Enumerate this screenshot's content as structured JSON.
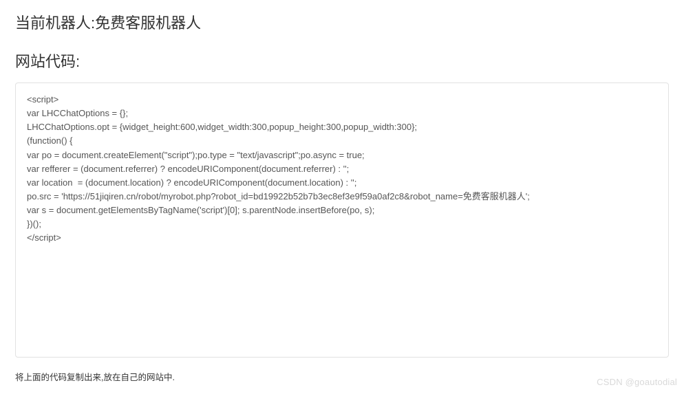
{
  "header": {
    "title": "当前机器人:免费客服机器人"
  },
  "section": {
    "title": "网站代码:"
  },
  "codebox": {
    "content": "<script>\nvar LHCChatOptions = {};\nLHCChatOptions.opt = {widget_height:600,widget_width:300,popup_height:300,popup_width:300};\n(function() {\nvar po = document.createElement(\"script\");po.type = \"text/javascript\";po.async = true;\nvar refferer = (document.referrer) ? encodeURIComponent(document.referrer) : '';\nvar location  = (document.location) ? encodeURIComponent(document.location) : '';\npo.src = 'https://51jiqiren.cn/robot/myrobot.php?robot_id=bd19922b52b7b3ec8ef3e9f59a0af2c8&robot_name=免费客服机器人';\nvar s = document.getElementsByTagName('script')[0]; s.parentNode.insertBefore(po, s);\n})();\n</script>"
  },
  "instruction": {
    "text": "将上面的代码复制出来,放在自己的网站中."
  },
  "watermark": {
    "text": "CSDN @goautodial"
  }
}
